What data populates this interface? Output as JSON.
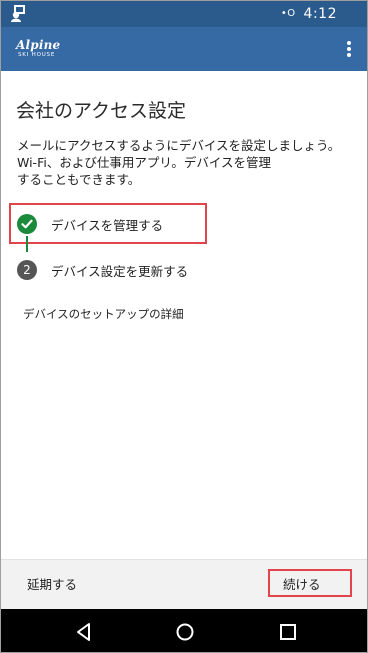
{
  "status_bar": {
    "time": "4:12",
    "indicator": "•O",
    "icons": [
      "user-notification-icon"
    ]
  },
  "app_bar": {
    "logo_main": "Alpine",
    "logo_sub": "SKI HOUSE",
    "menu_icon": "more-vert-icon"
  },
  "page": {
    "title": "会社のアクセス設定",
    "description_lines": [
      "メールにアクセスするようにデバイスを設定しましょう。",
      "Wi-Fi、および仕事用アプリ。デバイスを管理",
      "することもできます。"
    ]
  },
  "steps": [
    {
      "number": "1",
      "label": "デバイスを管理する",
      "status": "complete",
      "icon": "check-icon"
    },
    {
      "number": "2",
      "label": "デバイス設定を更新する",
      "status": "pending"
    }
  ],
  "details_link": "デバイスのセットアップの詳細",
  "actions": {
    "postpone": "延期する",
    "continue": "続ける"
  },
  "nav": {
    "back": "back-icon",
    "home": "home-icon",
    "recent": "recent-apps-icon"
  },
  "colors": {
    "status_bar": "#2b5a8c",
    "app_bar": "#356aa5",
    "success": "#1b8a3a",
    "highlight": "#e0454b"
  }
}
